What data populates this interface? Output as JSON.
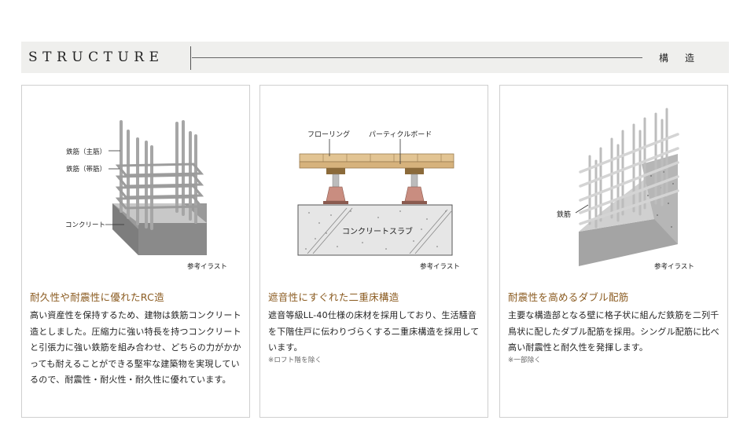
{
  "header": {
    "title": "STRUCTURE",
    "title_jp": "構造"
  },
  "cards": [
    {
      "illustration": {
        "labels": [
          "鉄筋（主筋）",
          "鉄筋（帯筋）",
          "コンクリート"
        ],
        "caption": "参考イラスト"
      },
      "title": "耐久性や耐震性に優れたRC造",
      "body": "高い資産性を保持するため、建物は鉄筋コンクリート造としました。圧縮力に強い特長を持つコンクリートと引張力に強い鉄筋を組み合わせ、どちらの力がかかっても耐えることができる堅牢な建築物を実現しているので、耐震性・耐火性・耐久性に優れています。",
      "note": ""
    },
    {
      "illustration": {
        "labels": [
          "フローリング",
          "パーティクルボード",
          "コンクリートスラブ"
        ],
        "caption": "参考イラスト"
      },
      "title": "遮音性にすぐれた二重床構造",
      "body": "遮音等級LL-40仕様の床材を採用しており、生活騒音を下階住戸に伝わりづらくする二重床構造を採用しています。",
      "note": "※ロフト階を除く"
    },
    {
      "illustration": {
        "labels": [
          "鉄筋"
        ],
        "caption": "参考イラスト"
      },
      "title": "耐震性を高めるダブル配筋",
      "body": "主要な構造部となる壁に格子状に組んだ鉄筋を二列千鳥状に配したダブル配筋を採用。シングル配筋に比べ高い耐震性と耐久性を発揮します。",
      "note": "※一部除く"
    }
  ],
  "colors": {
    "header_bg": "#efefed",
    "title_accent": "#8a5a1f",
    "card_border": "#cfcfcf"
  }
}
